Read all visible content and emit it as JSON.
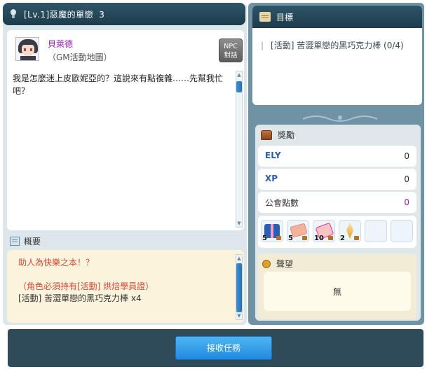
{
  "quest": {
    "level_tag": "[Lv.1]",
    "title": "惡魔的單戀",
    "number": "3"
  },
  "npc": {
    "name": "貝萊德",
    "map": "（GM活動地圖）",
    "chat_button": "NPC\n對話"
  },
  "dialog": {
    "text": "我是怎麼迷上皮歐妮亞的？這說來有點複雜……先幫我忙吧？"
  },
  "summary": {
    "label": "概要",
    "line1": "助人為快樂之本！？",
    "line2": "（角色必須持有[活動] 烘焙學員證）",
    "line3": "[活動] 苦澀單戀的黑巧克力棒 x4"
  },
  "goal": {
    "label": "目標",
    "item": "[活動] 苦澀單戀的黑巧克力棒 (0/4)"
  },
  "reward": {
    "label": "獎勵",
    "ely_label": "ELY",
    "ely_value": "0",
    "xp_label": "XP",
    "xp_value": "0",
    "guild_label": "公會點數",
    "guild_value": "0",
    "items": [
      {
        "icon": "gift-box-icon",
        "count": "5"
      },
      {
        "icon": "coupon-icon",
        "count": "5"
      },
      {
        "icon": "ticket-icon",
        "count": "10"
      },
      {
        "icon": "crystal-icon",
        "count": "2"
      }
    ]
  },
  "fame": {
    "label": "聲望",
    "value": "無"
  },
  "actions": {
    "accept": "接收任務"
  },
  "colors": {
    "title_bar": "#1d3c4c",
    "npc_name": "#9b1fb0",
    "accept_button": "#1f8ae0"
  }
}
